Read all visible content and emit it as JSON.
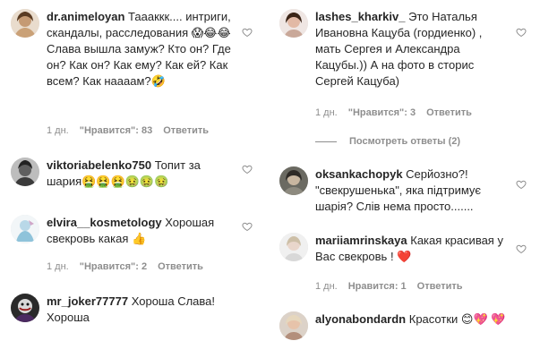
{
  "left": [
    {
      "username": "dr.animeloyan",
      "text": "Таааккк.... интриги, скандалы, расследования 😱😂😂 Слава вышла замуж? Кто он? Где он? Как он? Как ему? Как ей? Как всем? Как наааам?🤣",
      "time": "1 дн.",
      "likes": "\"Нравится\": 83",
      "reply": "Ответить"
    },
    {
      "username": "viktoriabelenko750",
      "text": "Топит за шария🤮🤮🤮🤢🤢🤢",
      "time": "",
      "likes": "",
      "reply": ""
    },
    {
      "username": "elvira__kosmetology",
      "text": "Хорошая свекровь какая 👍",
      "time": "1 дн.",
      "likes": "\"Нравится\": 2",
      "reply": "Ответить"
    },
    {
      "username": "mr_joker77777",
      "text": "Хороша Слава! Хороша",
      "time": "",
      "likes": "",
      "reply": ""
    }
  ],
  "right": [
    {
      "username": "lashes_kharkiv_",
      "text": "Это Наталья Ивановна Кацуба (гордиенко) , мать Сергея и Александра Кацубы.)) А на фото в сторис Сергей Кацуба)",
      "time": "1 дн.",
      "likes": "\"Нравится\": 3",
      "reply": "Ответить"
    },
    {
      "username": "oksankachopyk",
      "text": "Серйозно?! \"свекрушенька\", яка підтримує шарія? Слів нема просто.......",
      "time": "",
      "likes": "",
      "reply": ""
    },
    {
      "username": "mariiamrinskaya",
      "text": "Какая красивая у Вас свекровь ! ❤️",
      "time": "1 дн.",
      "likes": "Нравится: 1",
      "reply": "Ответить"
    },
    {
      "username": "alyonabondardn",
      "text": "Красотки 😊💖 💖",
      "time": "",
      "likes": "",
      "reply": ""
    }
  ],
  "view_replies": "Посмотреть ответы (2)",
  "colors": {
    "text": "#262626",
    "meta": "#8e8e8e"
  }
}
